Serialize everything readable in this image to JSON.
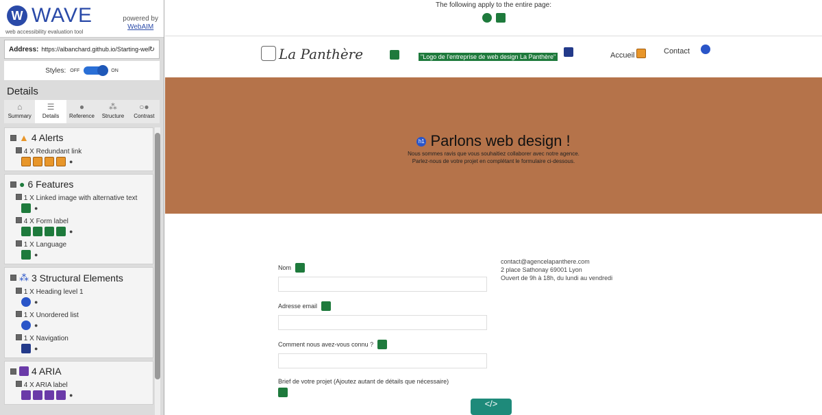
{
  "wave": {
    "logo_text": "WAVE",
    "logo_sub": "web accessibility evaluation tool",
    "powered_by": "powered by",
    "powered_link": "WebAIM",
    "address_label": "Address:",
    "address_value": "https://albanchard.github.io/Starting-websi",
    "styles_label": "Styles:",
    "styles_off": "OFF",
    "styles_on": "ON",
    "details_heading": "Details",
    "tabs": [
      {
        "label": "Summary"
      },
      {
        "label": "Details"
      },
      {
        "label": "Reference"
      },
      {
        "label": "Structure"
      },
      {
        "label": "Contrast"
      }
    ],
    "groups": [
      {
        "title": "4 Alerts",
        "items": [
          {
            "label": "4 X Redundant link"
          }
        ]
      },
      {
        "title": "6 Features",
        "items": [
          {
            "label": "1 X Linked image with alternative text"
          },
          {
            "label": "4 X Form label"
          },
          {
            "label": "1 X Language"
          }
        ]
      },
      {
        "title": "3 Structural Elements",
        "items": [
          {
            "label": "1 X Heading level 1"
          },
          {
            "label": "1 X Unordered list"
          },
          {
            "label": "1 X Navigation"
          }
        ]
      },
      {
        "title": "4 ARIA",
        "items": [
          {
            "label": "4 X ARIA label"
          }
        ]
      }
    ]
  },
  "page": {
    "topbar_text": "The following apply to the entire page:",
    "brand": "La Panthère",
    "alt_label": "\"Logo de l'entreprise de web design La Panthère\"",
    "nav_accueil": "Accueil",
    "nav_contact": "Contact",
    "hero_title": "Parlons web design !",
    "hero_line1": "Nous sommes ravis que vous souhaitiez collaborer avec notre agence.",
    "hero_line2": "Parlez-nous de votre projet en complétant le formulaire ci-dessous.",
    "form_labels": [
      "Nom",
      "Adresse email",
      "Comment nous avez-vous connu ?",
      "Brief de votre projet (Ajoutez autant de détails que nécessaire)"
    ],
    "contact_email": "contact@agencelapanthere.com",
    "contact_address": "2 place Sathonay 69001 Lyon",
    "contact_hours": "Ouvert de 9h à 18h, du lundi au vendredi",
    "code_badge": "</>",
    "h1_badge": "h1"
  }
}
